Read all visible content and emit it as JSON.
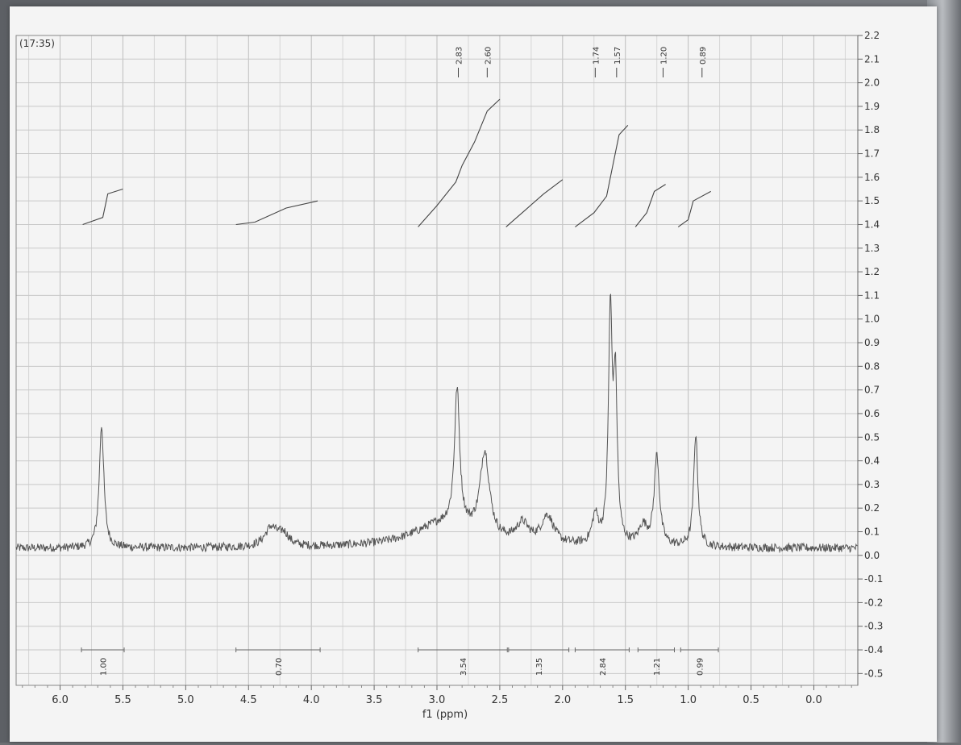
{
  "chart_data": {
    "type": "line",
    "title": "",
    "time_label": "(17:35)",
    "xlabel": "f1 (ppm)",
    "ylabel": "",
    "x_direction": "reversed",
    "xlim": [
      6.35,
      -0.35
    ],
    "ylim": [
      -0.55,
      2.2
    ],
    "grid": true,
    "x_ticks": [
      6.0,
      5.5,
      5.0,
      4.5,
      4.0,
      3.5,
      3.0,
      2.5,
      2.0,
      1.5,
      1.0,
      0.5,
      0.0
    ],
    "x_tick_labels": [
      "6.0",
      "5.5",
      "5.0",
      "4.5",
      "4.0",
      "3.5",
      "3.0",
      "2.5",
      "2.0",
      "1.5",
      "1.0",
      "0.5",
      "0.0"
    ],
    "y_ticks": [
      2.2,
      2.1,
      2.0,
      1.9,
      1.8,
      1.7,
      1.6,
      1.5,
      1.4,
      1.3,
      1.2,
      1.1,
      1.0,
      0.9,
      0.8,
      0.7,
      0.6,
      0.5,
      0.4,
      0.3,
      0.2,
      0.1,
      0.0,
      -0.1,
      -0.2,
      -0.3,
      -0.4,
      -0.5
    ],
    "y_tick_labels": [
      "2.2",
      "2.1",
      "2.0",
      "1.9",
      "1.8",
      "1.7",
      "1.6",
      "1.5",
      "1.4",
      "1.3",
      "1.2",
      "1.1",
      "1.0",
      "0.9",
      "0.8",
      "0.7",
      "0.6",
      "0.5",
      "0.4",
      "0.3",
      "0.2",
      "0.1",
      "0.0",
      "-0.1",
      "-0.2",
      "-0.3",
      "-0.4",
      "-0.5"
    ],
    "peak_labels": [
      {
        "ppm": 2.83,
        "label": "2.83"
      },
      {
        "ppm": 2.6,
        "label": "2.60"
      },
      {
        "ppm": 1.74,
        "label": "1.74"
      },
      {
        "ppm": 1.57,
        "label": "1.57"
      },
      {
        "ppm": 1.2,
        "label": "1.20"
      },
      {
        "ppm": 0.89,
        "label": "0.89"
      }
    ],
    "spectrum": {
      "baseline": 0.03,
      "noise": 0.018,
      "peaks": [
        {
          "ppm": 5.67,
          "height": 0.52,
          "width": 0.022
        },
        {
          "ppm": 4.32,
          "height": 0.08,
          "width": 0.06
        },
        {
          "ppm": 4.22,
          "height": 0.05,
          "width": 0.05
        },
        {
          "ppm": 2.84,
          "height": 0.58,
          "width": 0.025
        },
        {
          "ppm": 2.62,
          "height": 0.36,
          "width": 0.045
        },
        {
          "ppm": 2.32,
          "height": 0.08,
          "width": 0.06
        },
        {
          "ppm": 2.12,
          "height": 0.12,
          "width": 0.06
        },
        {
          "ppm": 1.74,
          "height": 0.12,
          "width": 0.03
        },
        {
          "ppm": 1.62,
          "height": 0.95,
          "width": 0.018
        },
        {
          "ppm": 1.58,
          "height": 0.65,
          "width": 0.018
        },
        {
          "ppm": 1.36,
          "height": 0.08,
          "width": 0.04
        },
        {
          "ppm": 1.25,
          "height": 0.38,
          "width": 0.025
        },
        {
          "ppm": 0.94,
          "height": 0.48,
          "width": 0.02
        },
        {
          "ppm": 2.95,
          "height": 0.1,
          "width": 0.3
        }
      ]
    },
    "integral_curves": [
      {
        "x": [
          5.82,
          5.66,
          5.62,
          5.5
        ],
        "y": [
          1.4,
          1.43,
          1.53,
          1.55
        ]
      },
      {
        "x": [
          4.6,
          4.45,
          4.2,
          3.95
        ],
        "y": [
          1.4,
          1.41,
          1.47,
          1.5
        ]
      },
      {
        "x": [
          3.15,
          3.0,
          2.85,
          2.8,
          2.7,
          2.6,
          2.5
        ],
        "y": [
          1.39,
          1.48,
          1.58,
          1.65,
          1.75,
          1.88,
          1.93
        ]
      },
      {
        "x": [
          2.45,
          2.3,
          2.15,
          2.0
        ],
        "y": [
          1.39,
          1.46,
          1.53,
          1.59
        ]
      },
      {
        "x": [
          1.9,
          1.75,
          1.65,
          1.6,
          1.55,
          1.48
        ],
        "y": [
          1.39,
          1.45,
          1.52,
          1.65,
          1.78,
          1.82
        ]
      },
      {
        "x": [
          1.42,
          1.33,
          1.27,
          1.18
        ],
        "y": [
          1.39,
          1.45,
          1.54,
          1.57
        ]
      },
      {
        "x": [
          1.08,
          1.0,
          0.96,
          0.82
        ],
        "y": [
          1.39,
          1.42,
          1.5,
          1.54
        ]
      }
    ],
    "integrals": [
      {
        "from": 5.83,
        "to": 5.49,
        "value": "1.00"
      },
      {
        "from": 4.6,
        "to": 3.93,
        "value": "0.70"
      },
      {
        "from": 3.15,
        "to": 2.44,
        "value": "3.54"
      },
      {
        "from": 2.43,
        "to": 1.95,
        "value": "1.35"
      },
      {
        "from": 1.9,
        "to": 1.47,
        "value": "2.84"
      },
      {
        "from": 1.4,
        "to": 1.11,
        "value": "1.21"
      },
      {
        "from": 1.06,
        "to": 0.76,
        "value": "0.99"
      }
    ]
  }
}
